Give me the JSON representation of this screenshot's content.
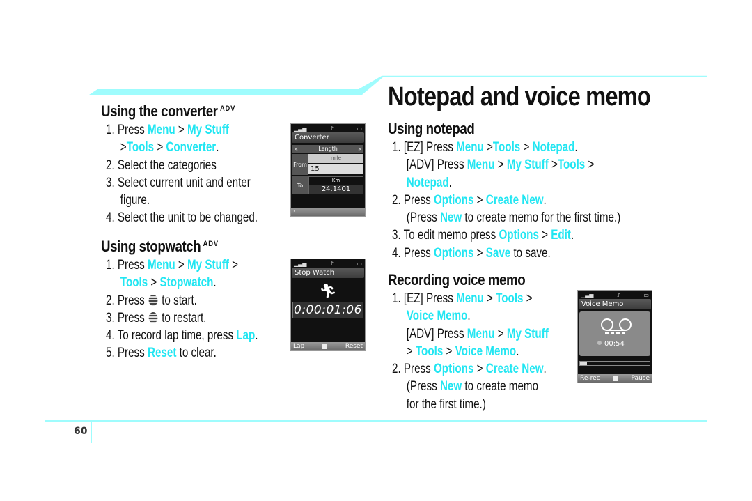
{
  "page": {
    "title": "Notepad and voice memo",
    "page_number": "60",
    "accent_color": "#22e6f2"
  },
  "converter": {
    "heading": "Using the converter",
    "badge": "ADV",
    "steps": [
      {
        "num": "1.",
        "parts": [
          "Press ",
          "Menu",
          " > ",
          "My Stuff"
        ]
      },
      {
        "cont": [
          ">",
          "Tools",
          " > ",
          "Converter",
          "."
        ]
      },
      {
        "num": "2.",
        "text": "Select the categories"
      },
      {
        "num": "3.",
        "text": "Select current unit and enter"
      },
      {
        "cont_text": "figure."
      },
      {
        "num": "4.",
        "text": "Select the unit to be changed."
      }
    ],
    "screen": {
      "title": "Converter",
      "category": "Length",
      "from_label": "From",
      "from_unit": "mile",
      "from_value": "15",
      "to_label": "To",
      "to_unit": "Km",
      "to_value": "24.1401"
    }
  },
  "stopwatch": {
    "heading": "Using stopwatch",
    "badge": "ADV",
    "s1": [
      "1. Press ",
      "Menu",
      " > ",
      "My Stuff",
      " >"
    ],
    "s1b": [
      "Tools",
      " > ",
      "Stopwatch",
      "."
    ],
    "s2": [
      "2. Press ",
      " to start."
    ],
    "s3": [
      "3. Press ",
      " to restart."
    ],
    "s4": [
      "4. To record lap time, press ",
      "Lap",
      "."
    ],
    "s5": [
      "5. Press ",
      "Reset",
      " to clear."
    ],
    "screen": {
      "title": "Stop Watch",
      "time": "0:00:01:06",
      "left_key": "Lap",
      "right_key": "Reset"
    }
  },
  "notepad": {
    "heading": "Using notepad",
    "l1": [
      "1. [EZ] Press ",
      "Menu",
      " >",
      "Tools",
      " > ",
      "Notepad",
      "."
    ],
    "l2": [
      "[ADV] Press ",
      "Menu",
      " > ",
      "My Stuff",
      " >",
      "Tools",
      " >"
    ],
    "l3": [
      "Notepad",
      "."
    ],
    "l4": [
      "2. Press ",
      "Options",
      " > ",
      "Create New",
      "."
    ],
    "l5": [
      "(Press ",
      "New",
      " to create memo for the first time.)"
    ],
    "l6": [
      "3. To edit memo press ",
      "Options",
      " > ",
      "Edit",
      "."
    ],
    "l7": [
      "4. Press ",
      "Options",
      " > ",
      "Save",
      " to save."
    ]
  },
  "voicememo": {
    "heading": "Recording voice memo",
    "l1": [
      "1. [EZ] Press ",
      "Menu",
      " > ",
      "Tools",
      " >"
    ],
    "l2": [
      "Voice Memo",
      "."
    ],
    "l3": [
      "[ADV] Press ",
      "Menu",
      " > ",
      "My Stuff"
    ],
    "l4": [
      "> ",
      "Tools",
      " > ",
      "Voice Memo",
      "."
    ],
    "l5": [
      "2. Press ",
      "Options",
      " > ",
      "Create New",
      "."
    ],
    "l6": [
      "(Press ",
      "New",
      " to create memo"
    ],
    "l7": [
      "for the first time.)"
    ],
    "screen": {
      "title": "Voice Memo",
      "time": "00:54",
      "progress": 0.1,
      "left_key": "Re-rec",
      "right_key": "Pause"
    }
  }
}
